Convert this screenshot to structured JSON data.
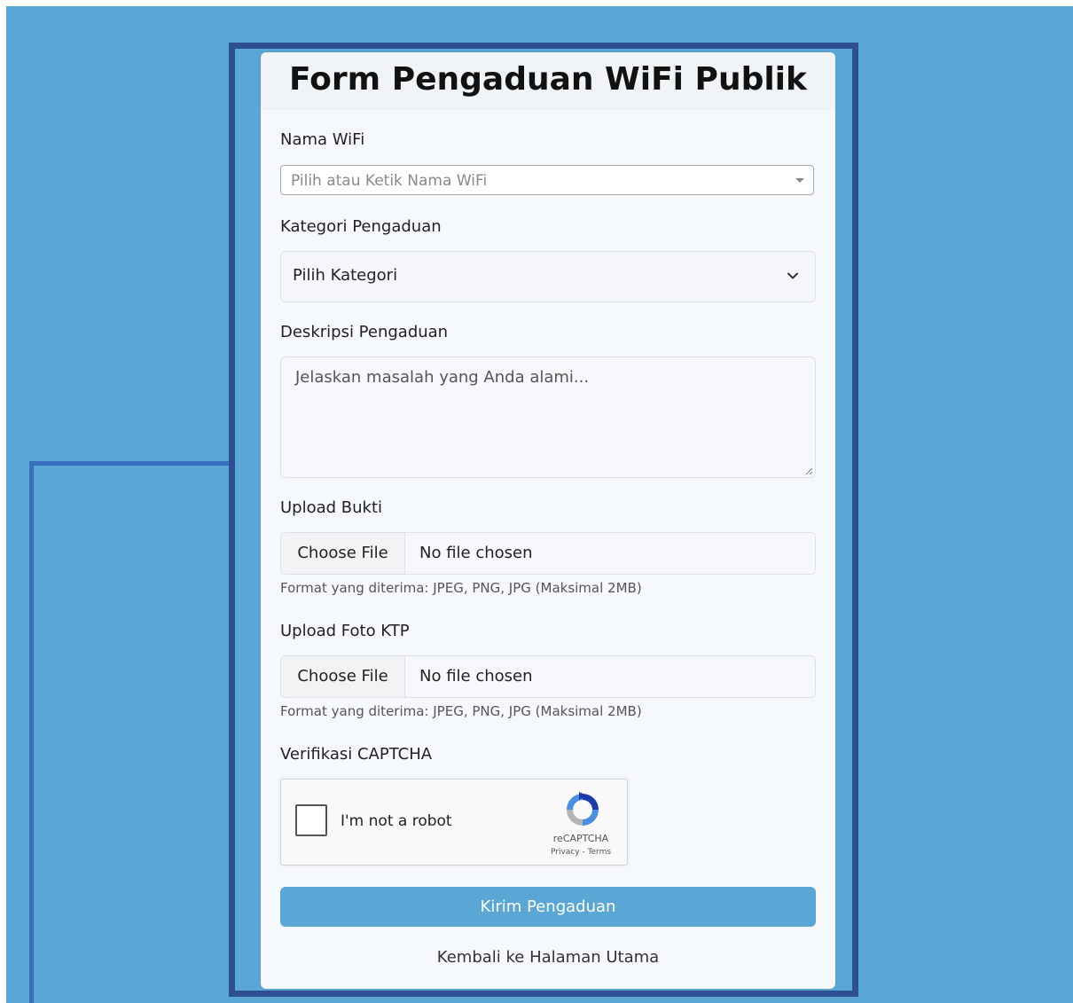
{
  "form": {
    "title": "Form Pengaduan WiFi Publik",
    "wifi": {
      "label": "Nama WiFi",
      "placeholder": "Pilih atau Ketik Nama WiFi"
    },
    "kategori": {
      "label": "Kategori Pengaduan",
      "selected": "Pilih Kategori"
    },
    "deskripsi": {
      "label": "Deskripsi Pengaduan",
      "placeholder": "Jelaskan masalah yang Anda alami..."
    },
    "bukti": {
      "label": "Upload Bukti",
      "button": "Choose File",
      "status": "No file chosen",
      "hint": "Format yang diterima: JPEG, PNG, JPG (Maksimal 2MB)"
    },
    "ktp": {
      "label": "Upload Foto KTP",
      "button": "Choose File",
      "status": "No file chosen",
      "hint": "Format yang diterima: JPEG, PNG, JPG (Maksimal 2MB)"
    },
    "captcha": {
      "label": "Verifikasi CAPTCHA",
      "text": "I'm not a robot",
      "brand": "reCAPTCHA",
      "links": "Privacy - Terms"
    },
    "submit": "Kirim Pengaduan",
    "back": "Kembali ke Halaman Utama"
  },
  "colors": {
    "background": "#5aa7d6",
    "frame": "#2f4f93",
    "accent": "#5aa7d6"
  },
  "icons": {
    "wifi_dropdown": "caret-down-icon",
    "kategori_dropdown": "chevron-down-icon",
    "captcha": "recaptcha-logo-icon"
  }
}
